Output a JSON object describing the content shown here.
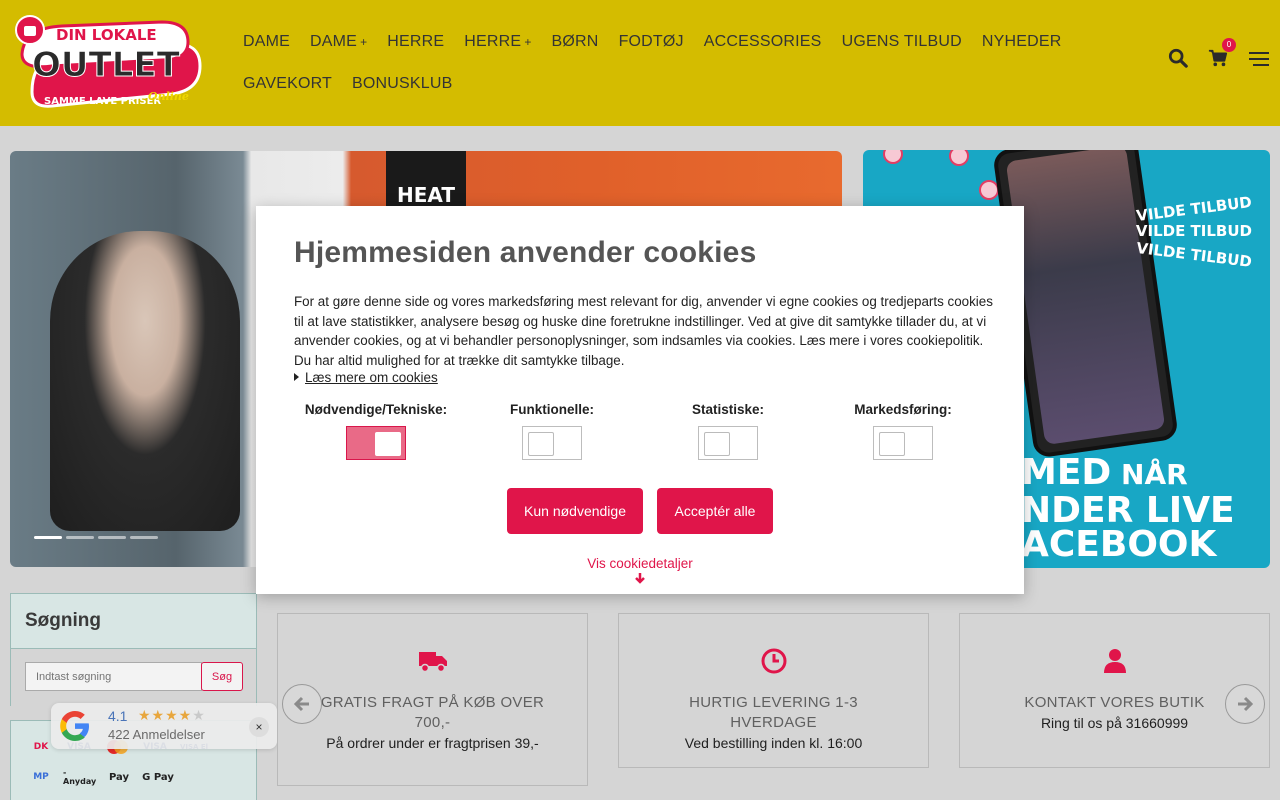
{
  "header": {
    "logo": {
      "top": "DIN LOKALE",
      "main": "OUTLET",
      "tagline": "SAMME LAVE PRISER",
      "tagline_script": "Online"
    },
    "nav": [
      {
        "label": "DAME",
        "plus": ""
      },
      {
        "label": "DAME",
        "plus": "+"
      },
      {
        "label": "HERRE",
        "plus": ""
      },
      {
        "label": "HERRE",
        "plus": "+"
      },
      {
        "label": "BØRN",
        "plus": ""
      },
      {
        "label": "FODTØJ",
        "plus": ""
      },
      {
        "label": "ACCESSORIES",
        "plus": ""
      },
      {
        "label": "UGENS TILBUD",
        "plus": ""
      },
      {
        "label": "NYHEDER",
        "plus": ""
      },
      {
        "label": "GAVEKORT",
        "plus": ""
      },
      {
        "label": "BONUSKLUB",
        "plus": ""
      }
    ],
    "cart_count": "0",
    "icons": [
      "search-icon",
      "cart-icon",
      "menu-icon"
    ]
  },
  "hero": {
    "left_brand_text": "HEAT",
    "slides_total": 4,
    "active_slide": 1,
    "right": {
      "promo_lines": [
        "VILDE TILBUD",
        "VILDE TILBUD",
        "VILDE TILBUD"
      ],
      "live_badge": "LIVE",
      "big_lines": [
        {
          "main": "MED",
          "small": " NÅR"
        },
        {
          "main": "NDER LIVE",
          "small": ""
        },
        {
          "main": "ACEBOOK",
          "small": ""
        }
      ]
    }
  },
  "cookie_modal": {
    "title": "Hjemmesiden anvender cookies",
    "text": "For at gøre denne side og vores markedsføring mest relevant for dig, anvender vi egne cookies og tredjeparts cookies til at lave statistikker, analysere besøg og huske dine foretrukne indstillinger. Ved at give dit samtykke tillader du, at vi anvender cookies, og at vi behandler personoplysninger, som indsamles via cookies. Læs mere i vores cookiepolitik. Du har altid mulighed for at trække dit samtykke tilbage.",
    "read_more": "Læs mere om cookies",
    "categories": [
      {
        "label": "Nødvendige/Tekniske:",
        "on": true
      },
      {
        "label": "Funktionelle:",
        "on": false
      },
      {
        "label": "Statistiske:",
        "on": false
      },
      {
        "label": "Markedsføring:",
        "on": false
      }
    ],
    "btn_necessary": "Kun nødvendige",
    "btn_accept_all": "Acceptér alle",
    "details_link": "Vis cookiedetaljer"
  },
  "sidebar": {
    "search_title": "Søgning",
    "search_placeholder": "Indtast søgning",
    "search_button": "Søg",
    "payment_methods": [
      "Dankort",
      "VISA",
      "Mastercard",
      "VISA",
      "VISA Elec",
      "MobilePay",
      "Anyday",
      "Apple Pay",
      "Google Pay"
    ]
  },
  "review_widget": {
    "score": "4.1",
    "stars_filled": 4,
    "stars_total": 5,
    "count": "422 Anmeldelser",
    "close": "×"
  },
  "features": [
    {
      "icon": "truck-icon",
      "title": "GRATIS FRAGT PÅ KØB OVER 700,-",
      "sub": "På ordrer under er fragtprisen 39,-"
    },
    {
      "icon": "clock-icon",
      "title": "HURTIG LEVERING 1-3 HVERDAGE",
      "sub": "Ved bestilling inden kl. 16:00"
    },
    {
      "icon": "user-icon",
      "title": "KONTAKT VORES BUTIK",
      "sub": "Ring til os på 31660999"
    }
  ],
  "colors": {
    "header_bg": "#d4bc00",
    "accent": "#e0154a",
    "page_bg": "#d5d5d5",
    "sidebar_bg": "#d8e6e4"
  }
}
